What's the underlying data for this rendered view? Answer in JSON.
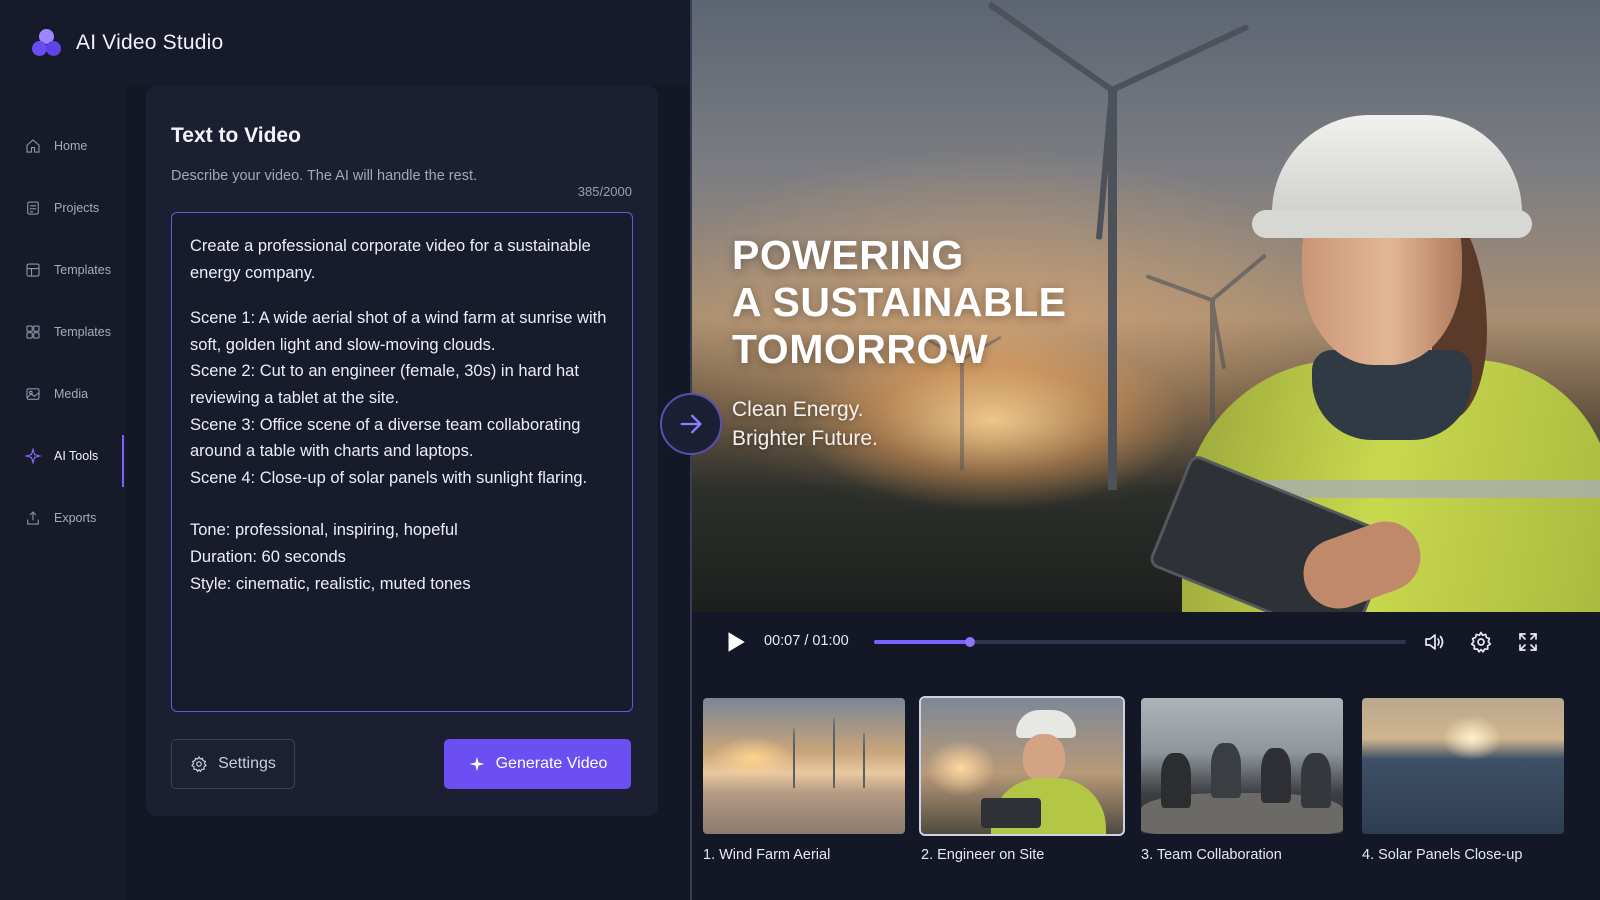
{
  "app": {
    "title": "AI Video Studio"
  },
  "sidebar": {
    "items": [
      {
        "label": "Home",
        "icon": "home-icon"
      },
      {
        "label": "Projects",
        "icon": "projects-icon"
      },
      {
        "label": "Templates",
        "icon": "templates-icon"
      },
      {
        "label": "Templates",
        "icon": "templates-grid-icon"
      },
      {
        "label": "Media",
        "icon": "media-icon"
      },
      {
        "label": "AI Tools",
        "icon": "sparkle-icon",
        "active": true
      },
      {
        "label": "Exports",
        "icon": "export-icon"
      }
    ]
  },
  "composer": {
    "title": "Text to Video",
    "subtitle": "Describe your video. The AI will handle the rest.",
    "char_count": "385/2000",
    "prompt": {
      "intro": "Create a professional corporate video for a sustainable energy company.",
      "scenes": [
        "Scene 1: A wide aerial shot of a wind farm at sunrise with soft, golden light and slow-moving clouds.",
        "Scene 2: Cut to an engineer (female, 30s) in hard hat reviewing a tablet at the site.",
        "Scene 3: Office scene of a diverse team collaborating around a table with charts and laptops.",
        "Scene 4: Close-up of solar panels with sunlight flaring."
      ],
      "tone": "Tone: professional, inspiring, hopeful",
      "duration": "Duration: 60 seconds",
      "style": "Style: cinematic, realistic, muted tones"
    },
    "settings_label": "Settings",
    "generate_label": "Generate Video"
  },
  "preview": {
    "headline": [
      "POWERING",
      "A SUSTAINABLE",
      "TOMORROW"
    ],
    "tagline": [
      "Clean Energy.",
      "Brighter Future."
    ]
  },
  "player": {
    "time": "00:07 / 01:00",
    "progress": 0.18,
    "accent_color": "#7b61ff"
  },
  "scenes": [
    {
      "label": "1. Wind Farm Aerial"
    },
    {
      "label": "2. Engineer on Site",
      "selected": true
    },
    {
      "label": "3. Team Collaboration"
    },
    {
      "label": "4. Solar Panels Close-up"
    }
  ]
}
